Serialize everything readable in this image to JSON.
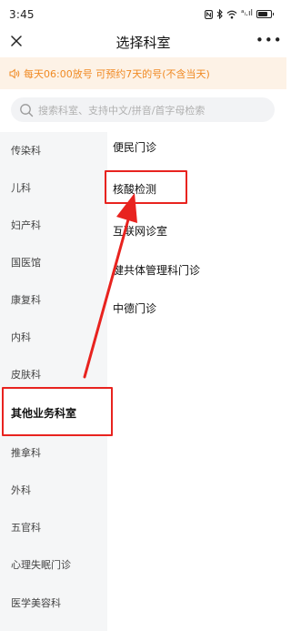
{
  "status_bar": {
    "time": "3:45",
    "icons": [
      "nfc-icon",
      "bluetooth-icon",
      "wifi-icon",
      "signal-icon",
      "battery-icon"
    ],
    "signal_text": "ᵃᵢ.ıl",
    "battery_level": 0.75
  },
  "header": {
    "title": "选择科室",
    "close_icon": "close-icon",
    "more_icon": "more-icon",
    "more_glyph": "•••"
  },
  "notice": {
    "icon": "speaker-icon",
    "text": "每天06:00放号 可预约7天的号(不含当天)",
    "color": "#f08a24",
    "background": "#fdf2e6"
  },
  "search": {
    "icon": "search-icon",
    "placeholder": "搜索科室、支持中文/拼音/首字母检索"
  },
  "sidebar": {
    "selected_index": 7,
    "items": [
      {
        "label": "传染科"
      },
      {
        "label": "儿科"
      },
      {
        "label": "妇产科"
      },
      {
        "label": "国医馆"
      },
      {
        "label": "康复科"
      },
      {
        "label": "内科"
      },
      {
        "label": "皮肤科"
      },
      {
        "label": "其他业务科室"
      },
      {
        "label": "推拿科"
      },
      {
        "label": "外科"
      },
      {
        "label": "五官科"
      },
      {
        "label": "心理失眠门诊"
      },
      {
        "label": "医学美容科"
      }
    ]
  },
  "sub_departments": {
    "items": [
      {
        "label": "便民门诊"
      },
      {
        "label": "核酸检测"
      },
      {
        "label": "互联网诊室"
      },
      {
        "label": "健共体管理科门诊"
      },
      {
        "label": "中德门诊"
      }
    ]
  },
  "annotations": {
    "highlight_color": "#e8231f"
  }
}
